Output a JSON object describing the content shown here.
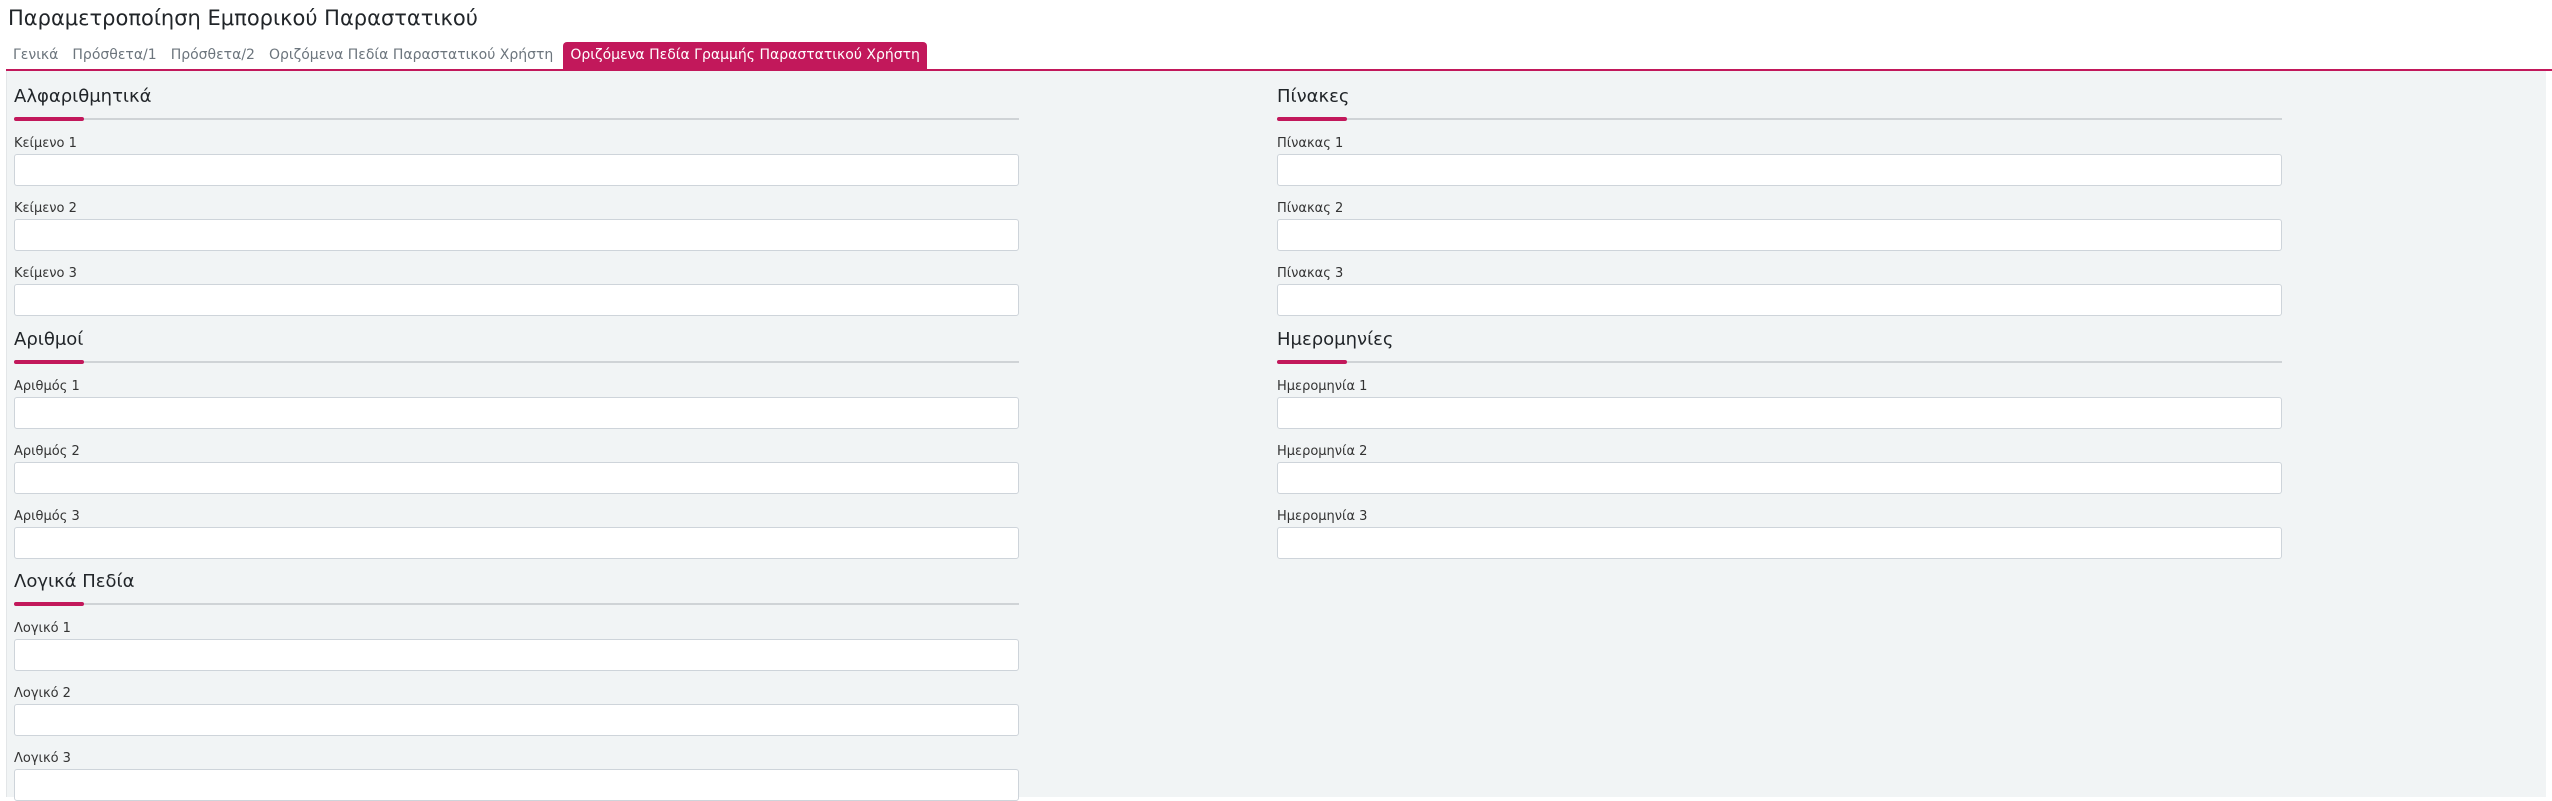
{
  "page": {
    "title": "Παραμετροποίηση Εμπορικού Παραστατικού"
  },
  "colors": {
    "accent": "#c2185b",
    "panel_background": "#f1f4f5"
  },
  "tabs": [
    {
      "label": "Γενικά",
      "active": false
    },
    {
      "label": "Πρόσθετα/1",
      "active": false
    },
    {
      "label": "Πρόσθετα/2",
      "active": false
    },
    {
      "label": "Οριζόμενα Πεδία Παραστατικού Χρήστη",
      "active": false
    },
    {
      "label": "Οριζόμενα Πεδία Γραμμής Παραστατικού Χρήστη",
      "active": true
    }
  ],
  "sections": {
    "alphanumeric": {
      "title": "Αλφαριθμητικά",
      "fields": [
        {
          "label": "Κείμενο 1",
          "value": ""
        },
        {
          "label": "Κείμενο 2",
          "value": ""
        },
        {
          "label": "Κείμενο 3",
          "value": ""
        }
      ]
    },
    "numbers": {
      "title": "Αριθμοί",
      "fields": [
        {
          "label": "Αριθμός 1",
          "value": ""
        },
        {
          "label": "Αριθμός 2",
          "value": ""
        },
        {
          "label": "Αριθμός 3",
          "value": ""
        }
      ]
    },
    "logical": {
      "title": "Λογικά Πεδία",
      "fields": [
        {
          "label": "Λογικό 1",
          "value": ""
        },
        {
          "label": "Λογικό 2",
          "value": ""
        },
        {
          "label": "Λογικό 3",
          "value": ""
        }
      ]
    },
    "tables": {
      "title": "Πίνακες",
      "fields": [
        {
          "label": "Πίνακας 1",
          "value": ""
        },
        {
          "label": "Πίνακας 2",
          "value": ""
        },
        {
          "label": "Πίνακας 3",
          "value": ""
        }
      ]
    },
    "dates": {
      "title": "Ημερομηνίες",
      "fields": [
        {
          "label": "Ημερομηνία 1",
          "value": ""
        },
        {
          "label": "Ημερομηνία 2",
          "value": ""
        },
        {
          "label": "Ημερομηνία 3",
          "value": ""
        }
      ]
    }
  }
}
